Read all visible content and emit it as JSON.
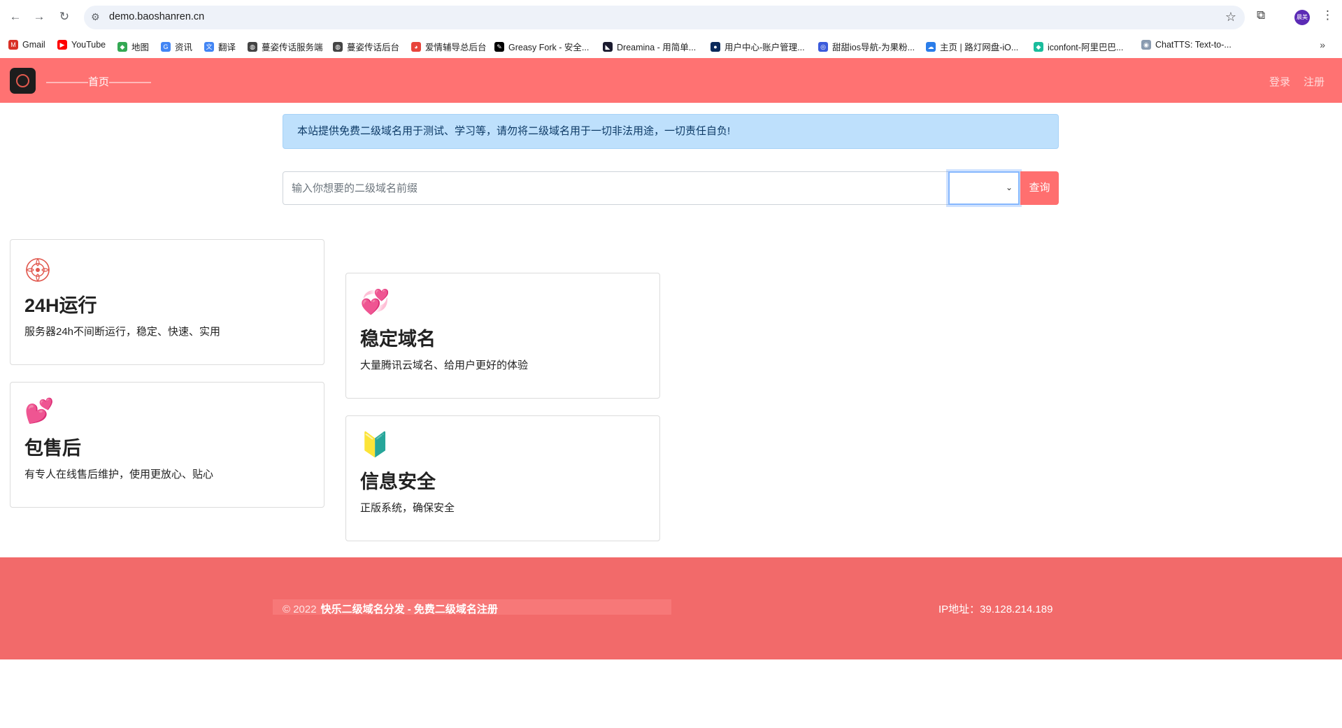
{
  "browser": {
    "url": "demo.baoshanren.cn",
    "avatar_text": "晨美",
    "bookmarks": [
      {
        "label": "Gmail",
        "icon": "gmail-icon",
        "color": "#d93025",
        "glyph": "M"
      },
      {
        "label": "YouTube",
        "icon": "youtube-icon",
        "color": "#ff0000",
        "glyph": "▶"
      },
      {
        "label": "地图",
        "icon": "maps-icon",
        "color": "#34a853",
        "glyph": "◆"
      },
      {
        "label": "资讯",
        "icon": "news-icon",
        "color": "#4285f4",
        "glyph": "G"
      },
      {
        "label": "翻译",
        "icon": "translate-icon",
        "color": "#4285f4",
        "glyph": "文"
      },
      {
        "label": "蔓姿传话服务端",
        "icon": "globe-icon",
        "color": "#444444",
        "glyph": "◍"
      },
      {
        "label": "蔓姿传话后台",
        "icon": "globe-icon",
        "color": "#444444",
        "glyph": "◍"
      },
      {
        "label": "爱情辅导总后台",
        "icon": "chrome-icon",
        "color": "#e8453c",
        "glyph": "◕"
      },
      {
        "label": "Greasy Fork - 安全...",
        "icon": "greasyfork-icon",
        "color": "#000000",
        "glyph": "✎"
      },
      {
        "label": "Dreamina - 用简单...",
        "icon": "dreamina-icon",
        "color": "#1a1a2e",
        "glyph": "◣"
      },
      {
        "label": "用户中心-账户管理...",
        "icon": "user-center-icon",
        "color": "#0b2a5b",
        "glyph": "●"
      },
      {
        "label": "甜甜ios导航-为果粉...",
        "icon": "ios-nav-icon",
        "color": "#3b5bdb",
        "glyph": "◎"
      },
      {
        "label": "主页 | 路灯网盘-iO...",
        "icon": "cloud-icon",
        "color": "#2b7de9",
        "glyph": "☁"
      },
      {
        "label": "iconfont-阿里巴巴...",
        "icon": "iconfont-icon",
        "color": "#1abc9c",
        "glyph": "◆"
      },
      {
        "label": "ChatTTS: Text-to-...",
        "icon": "chattts-icon",
        "color": "#8a9bb0",
        "glyph": "◉"
      }
    ]
  },
  "nav": {
    "home": "————首页————",
    "login": "登录",
    "register": "注册"
  },
  "notice": "本站提供免费二级域名用于测试、学习等，请勿将二级域名用于一切非法用途，一切责任自负!",
  "search": {
    "placeholder": "输入你想要的二级域名前缀",
    "select_value": "",
    "button": "查询"
  },
  "features": [
    {
      "emoji": "lotus-icon",
      "title": "24H运行",
      "desc": "服务器24h不间断运行，稳定、快速、实用"
    },
    {
      "emoji": "💞",
      "title": "稳定域名",
      "desc": "大量腾讯云域名、给用户更好的体验"
    },
    {
      "emoji": "💕",
      "title": "包售后",
      "desc": "有专人在线售后维护，使用更放心、贴心"
    },
    {
      "emoji": "🔰",
      "title": "信息安全",
      "desc": "正版系统，确保安全"
    }
  ],
  "footer": {
    "copyright": "© 2022",
    "site_name": "快乐二级域名分发 - 免费二级域名注册",
    "ip": "IP地址：39.128.214.189"
  },
  "colors": {
    "brand": "#ff7272",
    "footer": "#f26a6a",
    "notice_bg": "#bee0fc"
  }
}
